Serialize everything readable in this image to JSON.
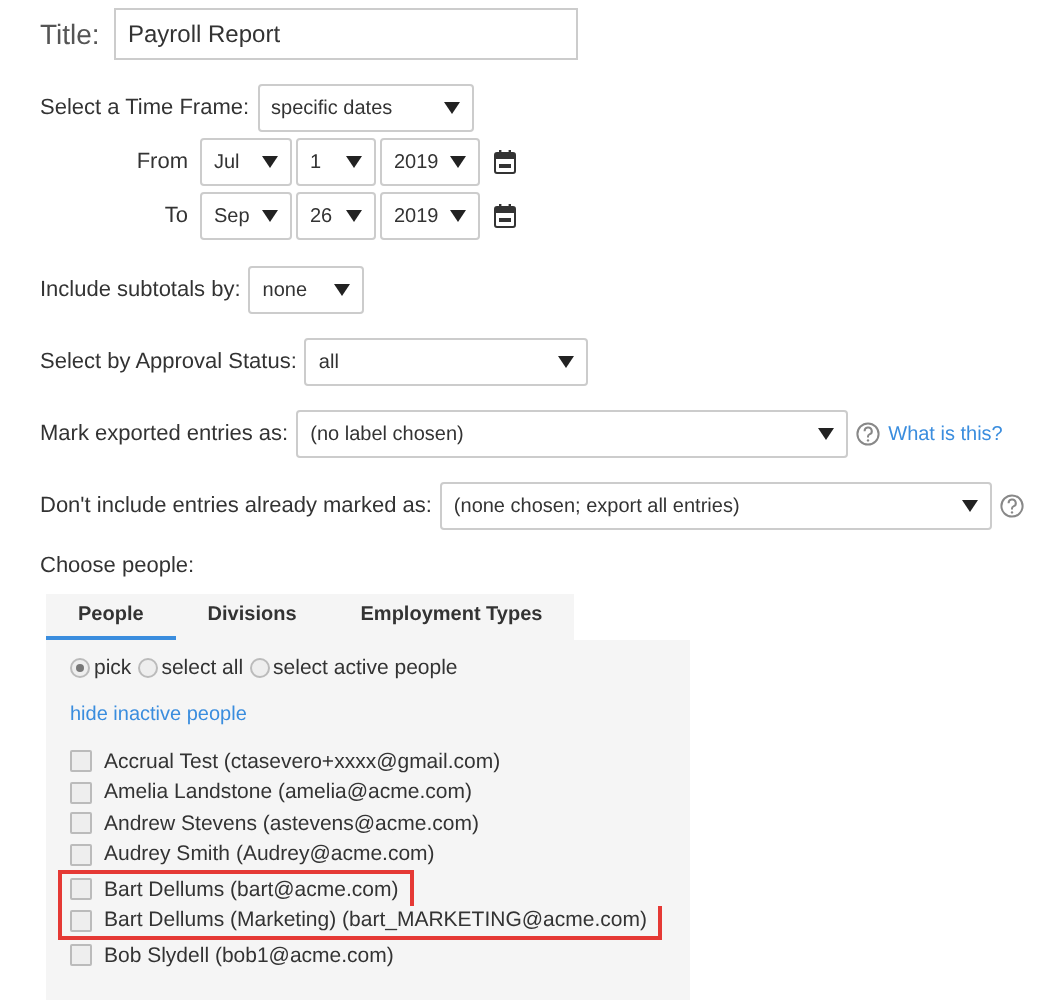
{
  "title_field": {
    "label": "Title:",
    "value": "Payroll Report"
  },
  "time_frame": {
    "label": "Select a Time Frame:",
    "value": "specific dates"
  },
  "date_rows": [
    {
      "label": "From",
      "month": "Jul",
      "day": "1",
      "year": "2019"
    },
    {
      "label": "To",
      "month": "Sep",
      "day": "26",
      "year": "2019"
    }
  ],
  "subtotals": {
    "label": "Include subtotals by:",
    "value": "none"
  },
  "approval": {
    "label": "Select by Approval Status:",
    "value": "all"
  },
  "mark_exported": {
    "label": "Mark exported entries as:",
    "value": "(no label chosen)",
    "help_link": "What is this?"
  },
  "exclude_marked": {
    "label": "Don't include entries already marked as:",
    "value": "(none chosen; export all entries)"
  },
  "people_section": {
    "label": "Choose people:",
    "tabs": [
      {
        "label": "People",
        "selected": true
      },
      {
        "label": "Divisions",
        "selected": false
      },
      {
        "label": "Employment Types",
        "selected": false
      }
    ],
    "modes": [
      {
        "label": "pick",
        "selected": true
      },
      {
        "label": "select all",
        "selected": false
      },
      {
        "label": "select active people",
        "selected": false
      }
    ],
    "toggle_link": "hide inactive people",
    "people": [
      {
        "label": "Accrual Test (ctasevero+xxxx@gmail.com)",
        "checked": false,
        "highlighted": false
      },
      {
        "label": "Amelia Landstone (amelia@acme.com)",
        "checked": false,
        "highlighted": false
      },
      {
        "label": "Andrew Stevens (astevens@acme.com)",
        "checked": false,
        "highlighted": false
      },
      {
        "label": "Audrey Smith (Audrey@acme.com)",
        "checked": false,
        "highlighted": false
      },
      {
        "label": "Bart Dellums (bart@acme.com)",
        "checked": false,
        "highlighted": true
      },
      {
        "label": "Bart Dellums (Marketing) (bart_MARKETING@acme.com)",
        "checked": false,
        "highlighted": true
      },
      {
        "label": "Bob Slydell (bob1@acme.com)",
        "checked": false,
        "highlighted": false
      }
    ]
  }
}
